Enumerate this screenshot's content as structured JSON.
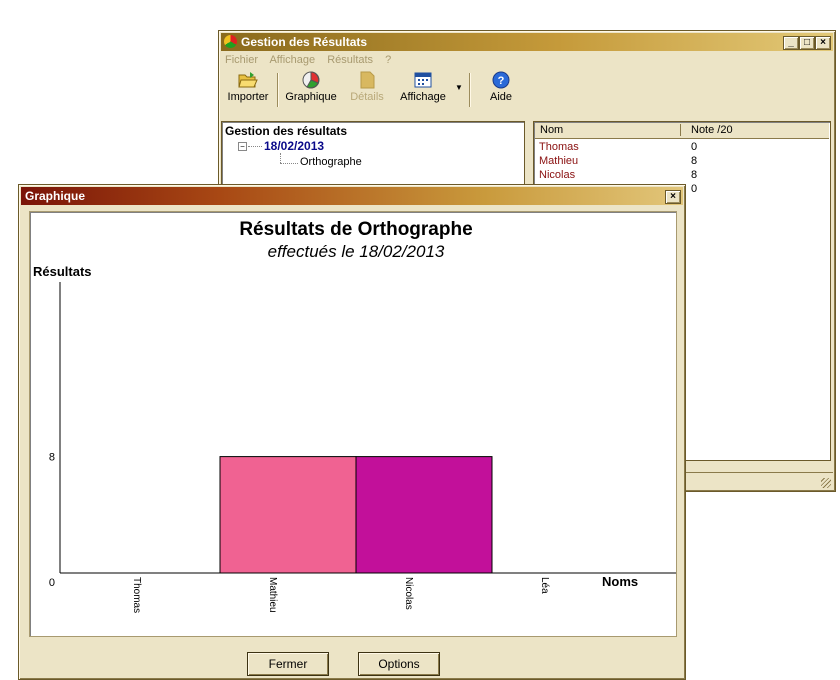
{
  "main_window": {
    "title": "Gestion des Résultats",
    "menu": [
      "Fichier",
      "Affichage",
      "Résultats",
      "?"
    ],
    "toolbar": {
      "import": "Importer",
      "chart": "Graphique",
      "details": "Détails",
      "view": "Affichage",
      "help": "Aide"
    },
    "tree": {
      "root": "Gestion des résultats",
      "date": "18/02/2013",
      "subject": "Orthographe"
    },
    "table": {
      "headers": [
        "Nom",
        "Note /20"
      ],
      "rows": [
        {
          "name": "Thomas",
          "grade": "0"
        },
        {
          "name": "Mathieu",
          "grade": "8"
        },
        {
          "name": "Nicolas",
          "grade": "8"
        },
        {
          "name": "",
          "grade": "0"
        }
      ]
    }
  },
  "chart_window": {
    "title": "Graphique",
    "close_button": "Fermer",
    "options_button": "Options"
  },
  "chart_data": {
    "type": "bar",
    "title": "Résultats de Orthographe",
    "subtitle": "effectués le 18/02/2013",
    "ylabel": "Résultats",
    "xlabel": "Noms",
    "categories": [
      "Thomas",
      "Mathieu",
      "Nicolas",
      "Léa"
    ],
    "values": [
      0,
      8,
      8,
      0
    ],
    "colors": [
      "#f06292",
      "#f06292",
      "#c2109a",
      "#c2109a"
    ],
    "y_ticks": [
      "0",
      "8"
    ],
    "ylim": [
      0,
      20
    ]
  },
  "colors": {
    "name_text": "#8a1010",
    "date_text": "#0a0a8a",
    "bar_mathieu": "#f06292",
    "bar_nicolas": "#c2109a"
  }
}
